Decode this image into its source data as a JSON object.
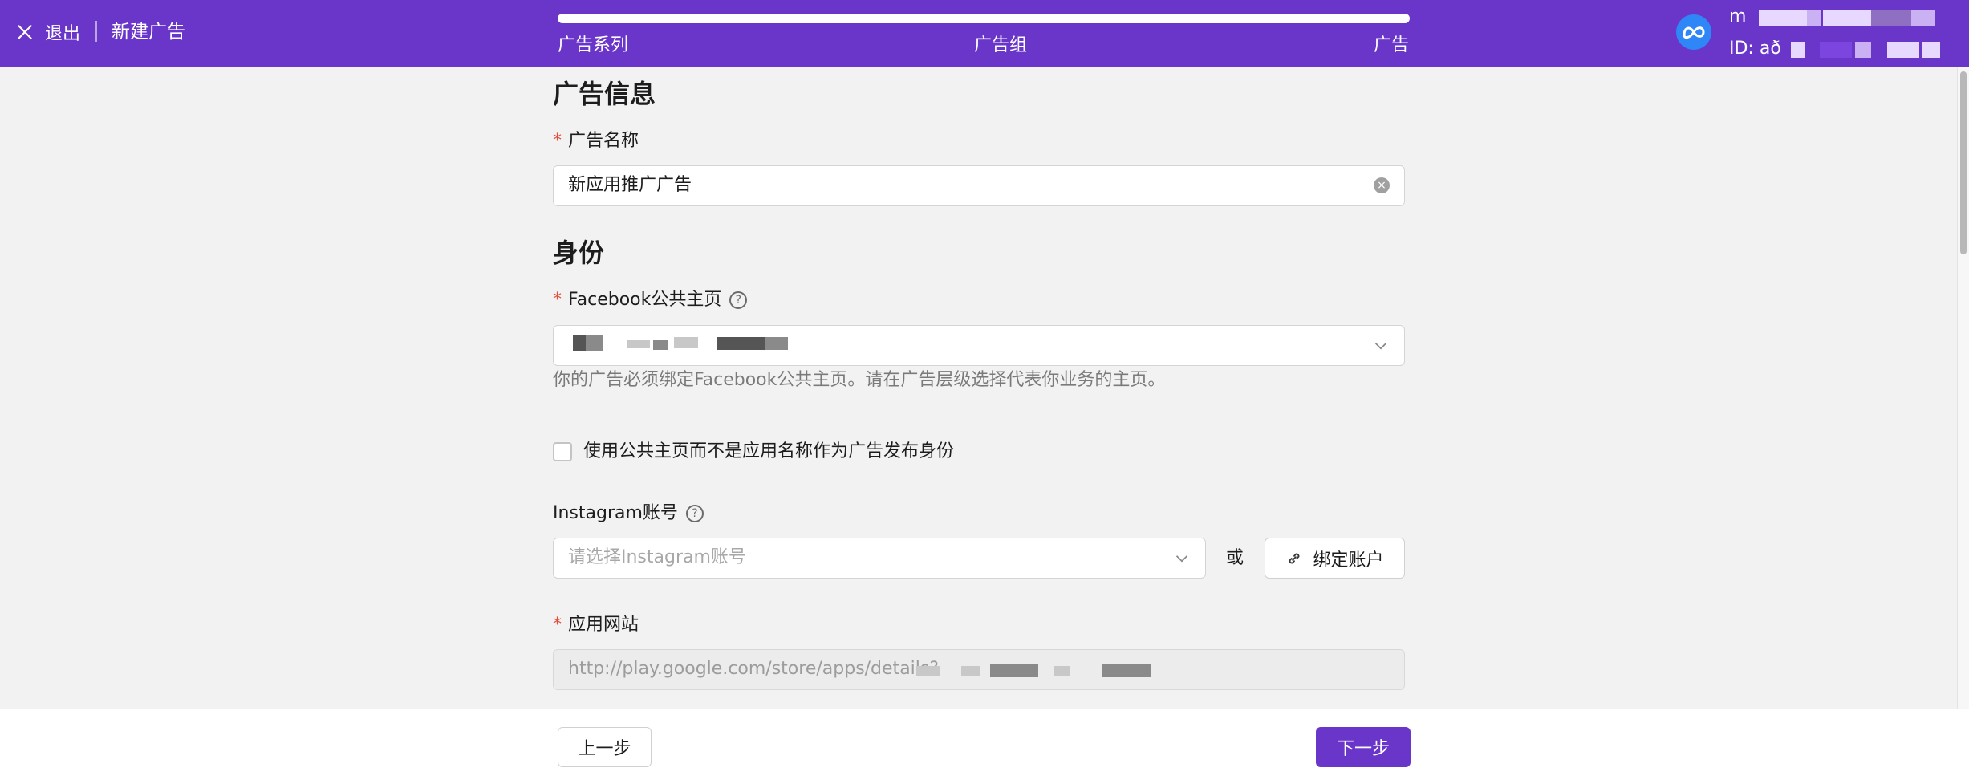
{
  "topbar": {
    "exit_label": "退出",
    "title": "新建广告",
    "steps": [
      "广告系列",
      "广告组",
      "广告"
    ],
    "progress_fraction": 1.0,
    "account_name_prefix": "m",
    "account_id_prefix": "ID: að",
    "logo_icon": "meta-logo-icon"
  },
  "ad_info": {
    "section_title": "广告信息",
    "name_label": "广告名称",
    "name_value": "新应用推广广告"
  },
  "identity": {
    "section_title": "身份",
    "fb_page_label": "Facebook公共主页",
    "fb_page_hint": "你的广告必须绑定Facebook公共主页。请在广告层级选择代表你业务的主页。",
    "use_page_checkbox_label": "使用公共主页而不是应用名称作为广告发布身份",
    "instagram_label": "Instagram账号",
    "instagram_placeholder": "请选择Instagram账号",
    "or_text": "或",
    "bind_account_label": "绑定账户",
    "app_site_label": "应用网站",
    "app_site_value": "http://play.google.com/store/apps/details?"
  },
  "footer": {
    "prev_label": "上一步",
    "next_label": "下一步"
  },
  "colors": {
    "brand": "#6a35c9",
    "required": "#e34d3b"
  }
}
